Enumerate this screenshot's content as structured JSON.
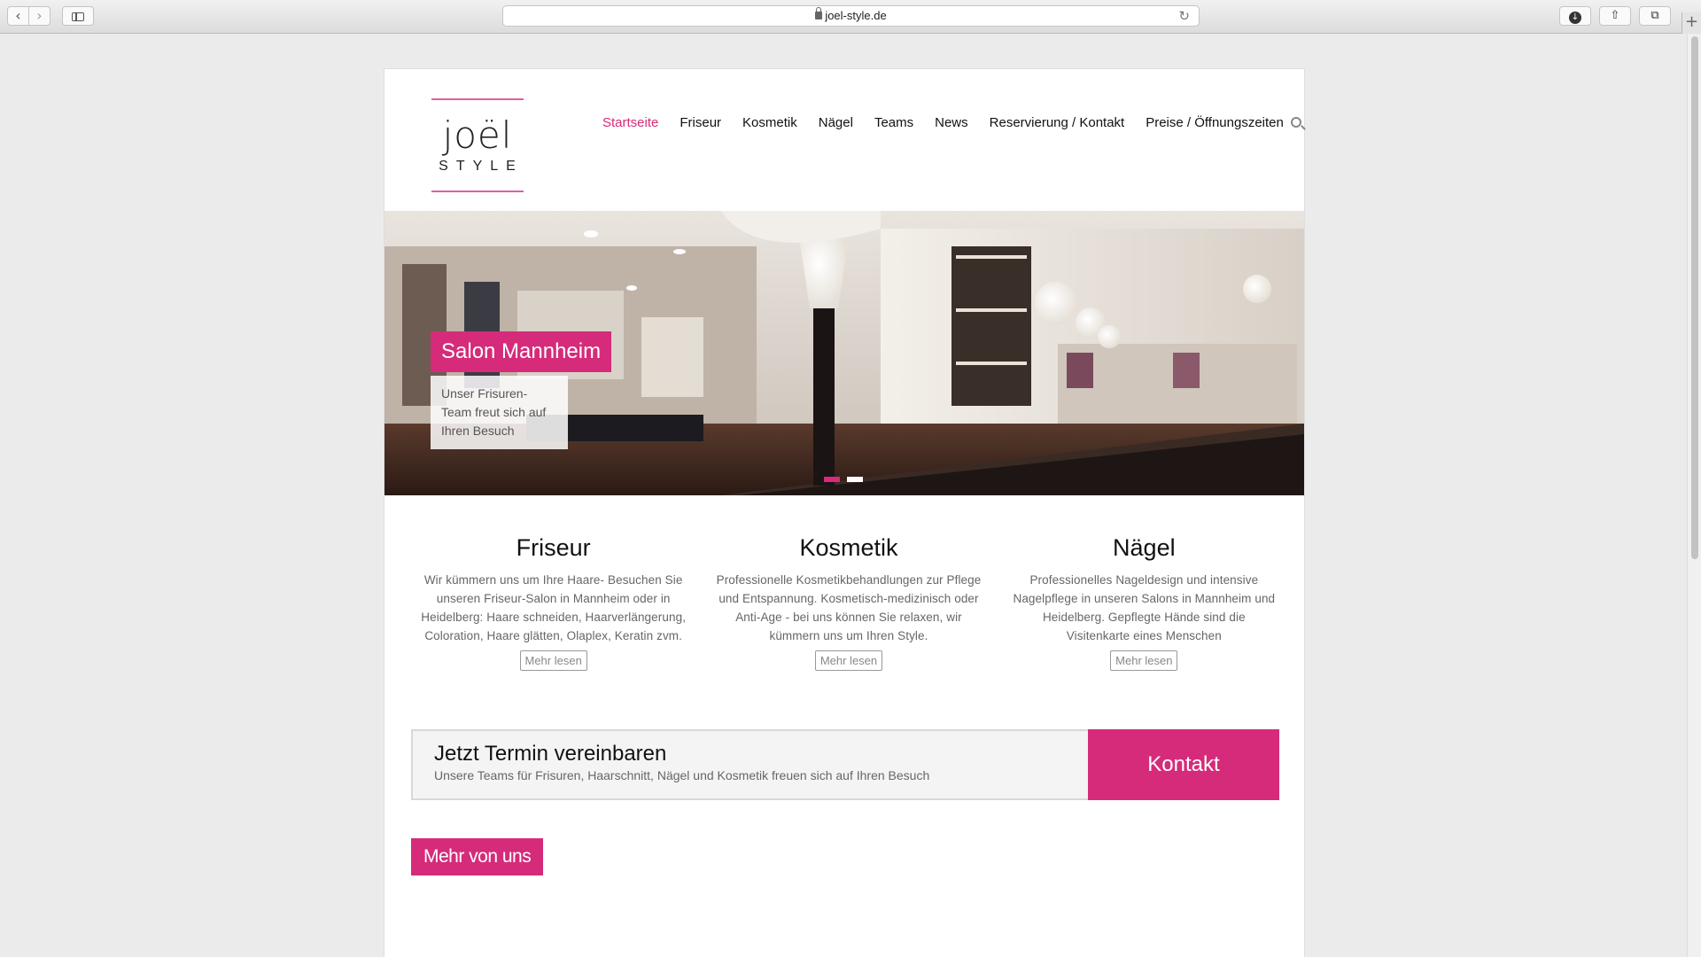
{
  "browser": {
    "url": "joel-style.de",
    "back": "‹",
    "forward": "›",
    "reload": "↻",
    "download": "↓",
    "share": "⇧",
    "tabs": "⧉",
    "new_tab": "+"
  },
  "logo": {
    "main": "joël",
    "sub": "STYLE"
  },
  "nav": {
    "items": [
      "Startseite",
      "Friseur",
      "Kosmetik",
      "Nägel",
      "Teams",
      "News",
      "Reservierung / Kontakt",
      "Preise / Öffnungszeiten"
    ],
    "active_index": 0,
    "icon": "search-icon"
  },
  "hero": {
    "title": "Salon Mannheim",
    "subtitle": "Unser Frisuren-Team freut sich auf Ihren Besuch",
    "slide_count": 2,
    "active_slide": 0
  },
  "services": [
    {
      "title": "Friseur",
      "text": "Wir kümmern uns um Ihre Haare- Besuchen Sie unseren Friseur-Salon in Mannheim oder in Heidelberg: Haare schneiden, Haarverlängerung, Coloration, Haare glätten, Olaplex, Keratin zvm.",
      "button": "Mehr lesen"
    },
    {
      "title": "Kosmetik",
      "text": "Professionelle Kosmetikbehandlungen zur Pflege und Entspannung. Kosmetisch-medizinisch oder Anti-Age - bei uns können Sie relaxen, wir kümmern uns um Ihren Style.",
      "button": "Mehr lesen"
    },
    {
      "title": "Nägel",
      "text": "Professionelles Nageldesign und intensive Nagelpflege in unseren Salons in Mannheim und Heidelberg. Gepflegte Hände sind die Visitenkarte eines Menschen",
      "button": "Mehr lesen"
    }
  ],
  "cta": {
    "title": "Jetzt Termin vereinbaren",
    "subtitle": "Unsere Teams für Frisuren, Haarschnitt, Nägel und Kosmetik freuen sich auf Ihren Besuch",
    "button": "Kontakt"
  },
  "more_button": "Mehr von uns",
  "colors": {
    "accent": "#d52b7a",
    "logo_line": "#e05fa3"
  }
}
